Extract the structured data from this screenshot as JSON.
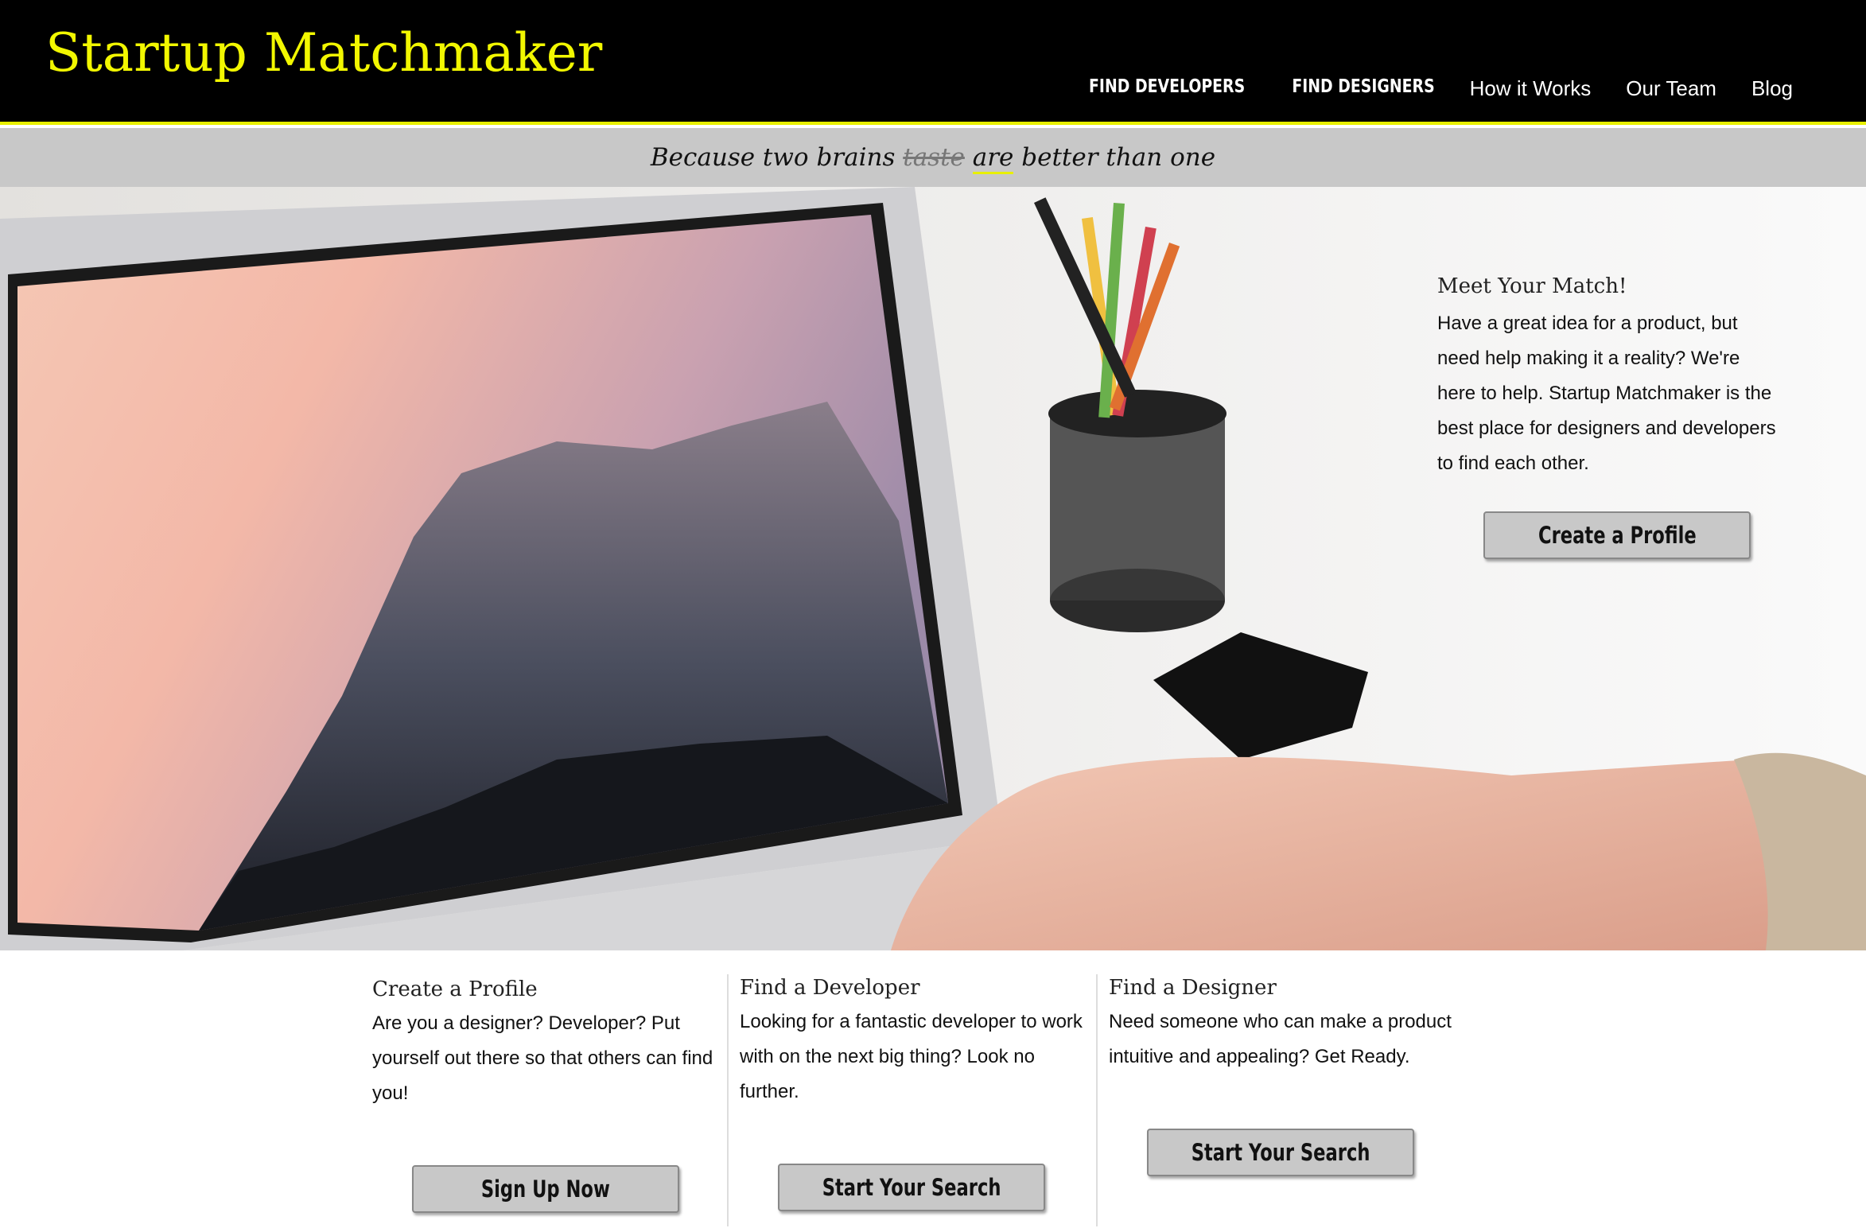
{
  "header": {
    "logo": "Startup Matchmaker",
    "nav": [
      {
        "label": "FIND DEVELOPERS"
      },
      {
        "label": "FIND DESIGNERS"
      },
      {
        "label": "How it Works"
      },
      {
        "label": "Our Team"
      },
      {
        "label": "Blog"
      }
    ]
  },
  "tagline": {
    "before": "Because two brains ",
    "struck": "taste",
    "replacement": "are",
    "after": " better than one"
  },
  "hero": {
    "image": "laptop-on-desk-photo",
    "heading": "Meet Your Match!",
    "body": "Have a great idea for a product, but need help making it a reality? We're here to help. Startup Matchmaker is the best place for designers and developers to find each other.",
    "button": "Create a Profile"
  },
  "features": [
    {
      "title": "Create a Profile",
      "body": "Are you a designer? Developer? Put yourself out there so that others can find you!",
      "button": "Sign Up Now"
    },
    {
      "title": "Find a Developer",
      "body": "Looking for a fantastic developer to work with on the next big thing? Look no further.",
      "button": "Start Your Search"
    },
    {
      "title": "Find a Designer",
      "body": "Need someone who can make a product intuitive and appealing? Get Ready.",
      "button": "Start Your Search"
    }
  ],
  "colors": {
    "header_bg": "#000000",
    "accent_yellow": "#f2f700",
    "tagline_bg": "#c8c8c8",
    "button_bg": "#c8c8c8"
  }
}
